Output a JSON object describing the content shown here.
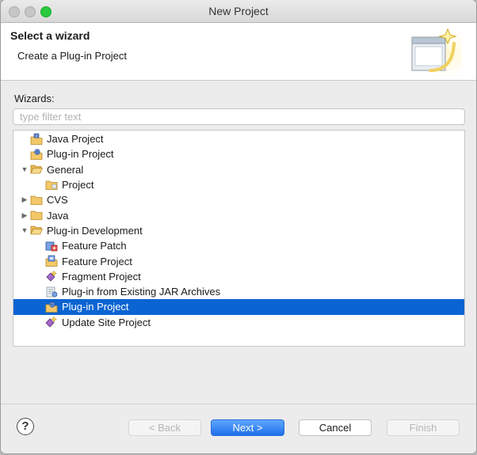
{
  "window": {
    "title": "New Project"
  },
  "header": {
    "title": "Select a wizard",
    "description": "Create a Plug-in Project"
  },
  "wizards": {
    "label": "Wizards:",
    "filter_placeholder": "type filter text",
    "filter_value": "",
    "tree": [
      {
        "label": "Java Project",
        "icon": "java-project-icon",
        "toggle": "none",
        "indent": 0,
        "selected": false
      },
      {
        "label": "Plug-in Project",
        "icon": "plugin-project-icon",
        "toggle": "none",
        "indent": 0,
        "selected": false
      },
      {
        "label": "General",
        "icon": "folder-open-icon",
        "toggle": "expanded",
        "indent": 0,
        "selected": false
      },
      {
        "label": "Project",
        "icon": "project-icon",
        "toggle": "none",
        "indent": 1,
        "selected": false
      },
      {
        "label": "CVS",
        "icon": "folder-icon",
        "toggle": "collapsed",
        "indent": 0,
        "selected": false
      },
      {
        "label": "Java",
        "icon": "folder-icon",
        "toggle": "collapsed",
        "indent": 0,
        "selected": false
      },
      {
        "label": "Plug-in Development",
        "icon": "folder-open-icon",
        "toggle": "expanded",
        "indent": 0,
        "selected": false
      },
      {
        "label": "Feature Patch",
        "icon": "feature-patch-icon",
        "toggle": "none",
        "indent": 1,
        "selected": false
      },
      {
        "label": "Feature Project",
        "icon": "feature-project-icon",
        "toggle": "none",
        "indent": 1,
        "selected": false
      },
      {
        "label": "Fragment Project",
        "icon": "fragment-project-icon",
        "toggle": "none",
        "indent": 1,
        "selected": false
      },
      {
        "label": "Plug-in from Existing JAR Archives",
        "icon": "plugin-from-jar-icon",
        "toggle": "none",
        "indent": 1,
        "selected": false
      },
      {
        "label": "Plug-in Project",
        "icon": "plugin-project-icon",
        "toggle": "none",
        "indent": 1,
        "selected": true
      },
      {
        "label": "Update Site Project",
        "icon": "update-site-icon",
        "toggle": "none",
        "indent": 1,
        "selected": false
      }
    ]
  },
  "buttons": {
    "help": "?",
    "back": "< Back",
    "next": "Next >",
    "cancel": "Cancel",
    "finish": "Finish"
  },
  "colors": {
    "selection": "#0a64d2",
    "default_button": "#1f6fe9",
    "folder": "#e8b85a"
  }
}
